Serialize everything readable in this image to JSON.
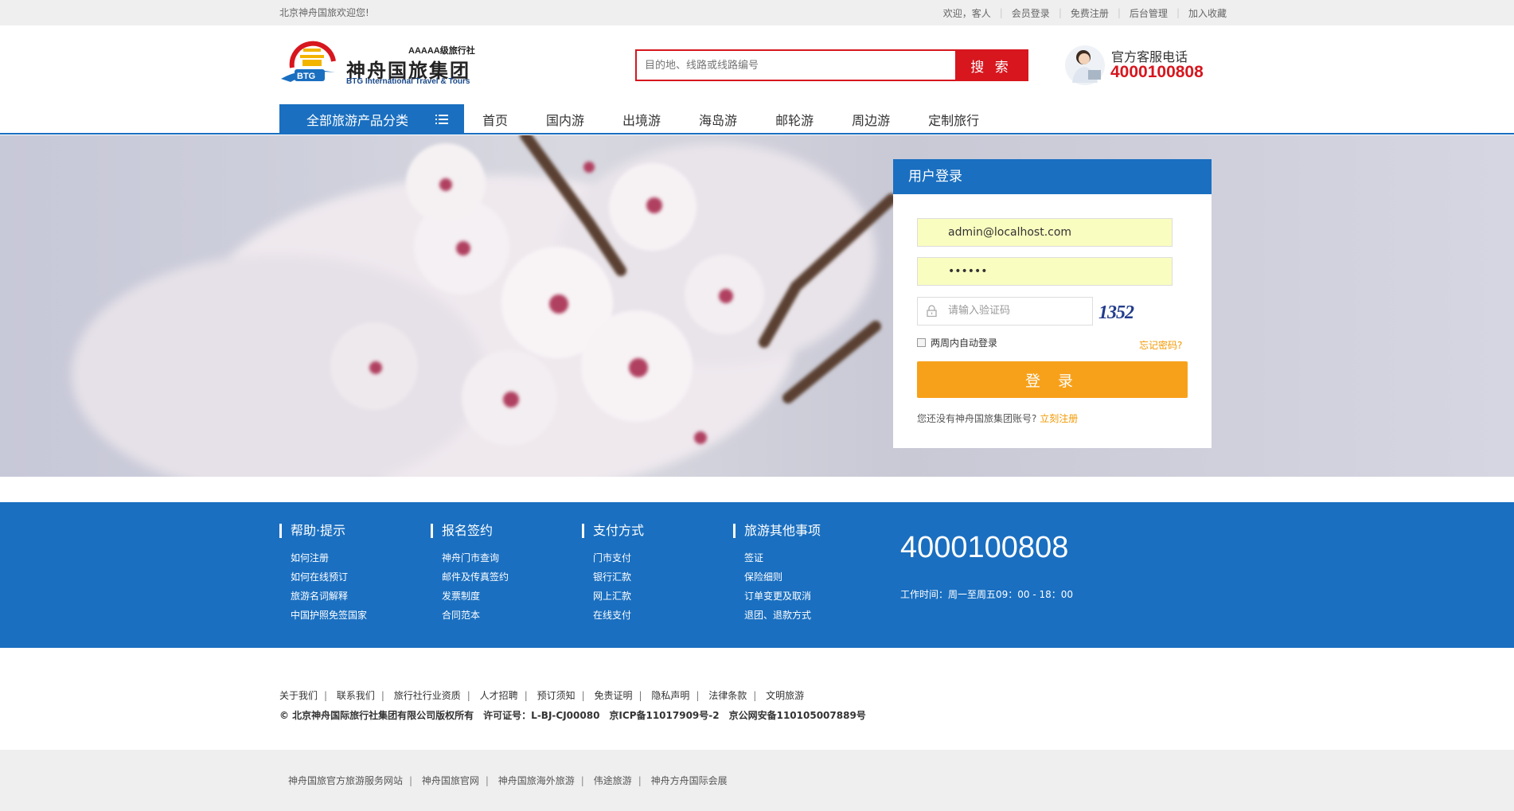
{
  "topbar": {
    "greeting": "北京神舟国旅欢迎您!",
    "links": [
      "欢迎，客人",
      "会员登录",
      "免费注册",
      "后台管理",
      "加入收藏"
    ]
  },
  "logo": {
    "badge": "BTG",
    "grade": "AAAAA级旅行社",
    "name_cn": "神舟国旅集团",
    "name_en": "BTG International Travel & Tours"
  },
  "search": {
    "placeholder": "目的地、线路或线路编号",
    "button": "搜 索"
  },
  "service": {
    "label": "官方客服电话",
    "phone": "4000100808"
  },
  "nav": {
    "category_button": "全部旅游产品分类",
    "items": [
      "首页",
      "国内游",
      "出境游",
      "海岛游",
      "邮轮游",
      "周边游",
      "定制旅行"
    ]
  },
  "login": {
    "title": "用户登录",
    "email_value": "admin@localhost.com",
    "password_value": "••••••",
    "captcha_placeholder": "请输入验证码",
    "captcha_code": "1352",
    "remember_label": "两周内自动登录",
    "forgot": "忘记密码?",
    "submit": "登 录",
    "no_account": "您还没有神舟国旅集团账号?",
    "register": "立刻注册"
  },
  "footer": {
    "columns": [
      {
        "title": "帮助·提示",
        "links": [
          "如何注册",
          "如何在线预订",
          "旅游名词解释",
          "中国护照免签国家"
        ]
      },
      {
        "title": "报名签约",
        "links": [
          "神舟门市查询",
          "邮件及传真签约",
          "发票制度",
          "合同范本"
        ]
      },
      {
        "title": "支付方式",
        "links": [
          "门市支付",
          "银行汇款",
          "网上汇款",
          "在线支付"
        ]
      },
      {
        "title": "旅游其他事项",
        "links": [
          "签证",
          "保险细则",
          "订单变更及取消",
          "退团、退款方式"
        ]
      }
    ],
    "phone": "4000100808",
    "hours": "工作时间：周一至周五09：00 - 18：00"
  },
  "legal": {
    "links": [
      "关于我们",
      "联系我们",
      "旅行社行业资质",
      "人才招聘",
      "预订须知",
      "免责证明",
      "隐私声明",
      "法律条款",
      "文明旅游"
    ],
    "copyright": "© 北京神舟国际旅行社集团有限公司版权所有　许可证号：L-BJ-CJ00080　京ICP备11017909号-2　京公网安备110105007889号"
  },
  "bottom_links": [
    "神舟国旅官方旅游服务网站",
    "神舟国旅官网",
    "神舟国旅海外旅游",
    "伟途旅游",
    "神舟方舟国际会展"
  ],
  "colors": {
    "brand_blue": "#1a6fc0",
    "brand_red": "#d7161e",
    "accent_orange": "#f7a11a"
  }
}
